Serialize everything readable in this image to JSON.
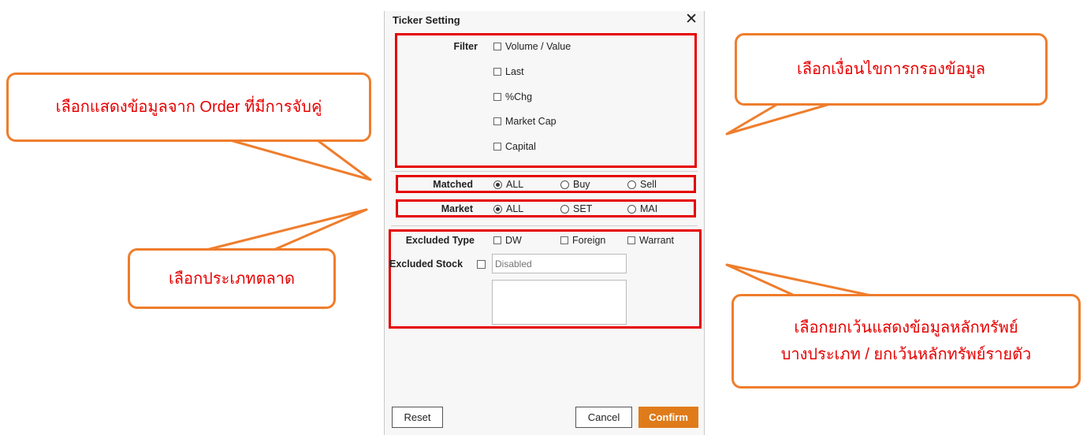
{
  "dialog": {
    "title": "Ticker Setting",
    "close_glyph": "✕",
    "filter": {
      "label": "Filter",
      "options": [
        "Volume / Value",
        "Last",
        "%Chg",
        "Market Cap",
        "Capital"
      ]
    },
    "matched": {
      "label": "Matched",
      "options": [
        "ALL",
        "Buy",
        "Sell"
      ],
      "selected": "ALL"
    },
    "market": {
      "label": "Market",
      "options": [
        "ALL",
        "SET",
        "MAI"
      ],
      "selected": "ALL"
    },
    "excluded_type": {
      "label": "Excluded Type",
      "options": [
        "DW",
        "Foreign",
        "Warrant"
      ]
    },
    "excluded_stock": {
      "label": "Excluded Stock",
      "placeholder": "Disabled"
    },
    "buttons": {
      "reset": "Reset",
      "cancel": "Cancel",
      "confirm": "Confirm"
    }
  },
  "callouts": {
    "matched": "เลือกแสดงข้อมูลจาก Order ที่มีการจับคู่",
    "filter": "เลือกเงื่อนไขการกรองข้อมูล",
    "market": "เลือกประเภทตลาด",
    "excluded_line1": "เลือกยกเว้นแสดงข้อมูลหลักทรัพย์",
    "excluded_line2": "บางประเภท / ยกเว้นหลักทรัพย์รายตัว"
  },
  "colors": {
    "accent_orange": "#e07b1a",
    "highlight_red": "#e60000",
    "callout_border": "#ef7d2c"
  }
}
